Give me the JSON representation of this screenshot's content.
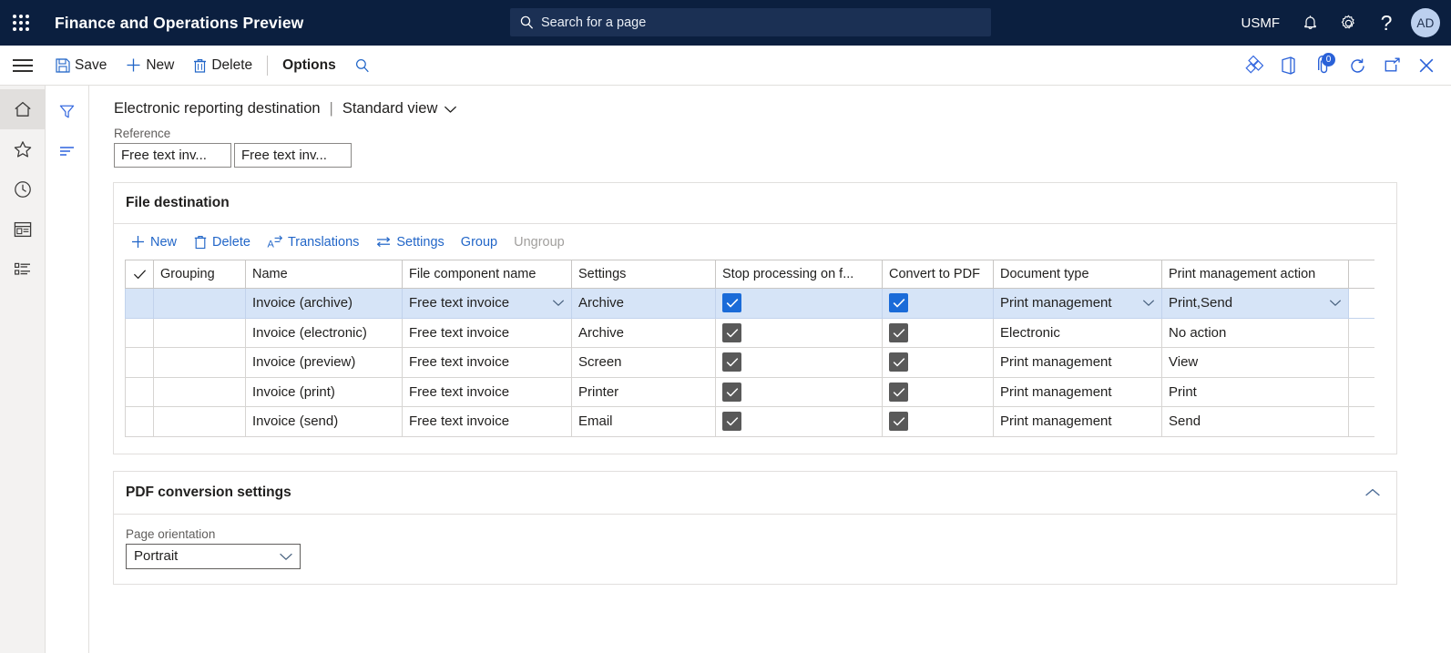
{
  "topbar": {
    "waffle_label": "App launcher",
    "app_title": "Finance and Operations Preview",
    "search_placeholder": "Search for a page",
    "search_value": "",
    "company": "USMF",
    "avatar_initials": "AD",
    "bg_color": "#0b1f3f",
    "search_bg": "#1b3054"
  },
  "commandbar": {
    "save_label": "Save",
    "new_label": "New",
    "delete_label": "Delete",
    "options_label": "Options",
    "notification_count": "0",
    "accent_color": "#2a61d8"
  },
  "navrail": {
    "items": [
      {
        "name": "home",
        "label": "Home",
        "active": true
      },
      {
        "name": "favorites",
        "label": "Favorites",
        "active": false
      },
      {
        "name": "recent",
        "label": "Recent",
        "active": false
      },
      {
        "name": "workspaces",
        "label": "Workspaces",
        "active": false
      },
      {
        "name": "modules",
        "label": "Modules",
        "active": false
      }
    ]
  },
  "filterrail": {
    "filter_label": "Filter",
    "sort_label": "Sort"
  },
  "page": {
    "title": "Electronic reporting destination",
    "separator": "|",
    "view_name": "Standard view",
    "reference_label": "Reference",
    "reference_fields": [
      "Free text inv...",
      "Free text inv..."
    ]
  },
  "file_destination": {
    "section_title": "File destination",
    "toolbar": [
      {
        "label": "New",
        "icon": "plus-icon",
        "disabled": false
      },
      {
        "label": "Delete",
        "icon": "trash-icon",
        "disabled": false
      },
      {
        "label": "Translations",
        "icon": "translate-icon",
        "disabled": false
      },
      {
        "label": "Settings",
        "icon": "settings-arrows-icon",
        "disabled": false
      },
      {
        "label": "Group",
        "icon": "none",
        "disabled": false
      },
      {
        "label": "Ungroup",
        "icon": "none",
        "disabled": true
      }
    ],
    "columns": [
      "Grouping",
      "Name",
      "File component name",
      "Settings",
      "Stop processing on f...",
      "Convert to PDF",
      "Document type",
      "Print management action"
    ],
    "rows": [
      {
        "selected": true,
        "grouping": "",
        "name": "Invoice (archive)",
        "file_component_name": "Free text invoice",
        "settings": "Archive",
        "stop_processing": true,
        "convert_to_pdf": true,
        "document_type": "Print management",
        "print_management_action": "Print,Send"
      },
      {
        "selected": false,
        "grouping": "",
        "name": "Invoice (electronic)",
        "file_component_name": "Free text invoice",
        "settings": "Archive",
        "stop_processing": true,
        "convert_to_pdf": true,
        "document_type": "Electronic",
        "print_management_action": "No action"
      },
      {
        "selected": false,
        "grouping": "",
        "name": "Invoice (preview)",
        "file_component_name": "Free text invoice",
        "settings": "Screen",
        "stop_processing": true,
        "convert_to_pdf": true,
        "document_type": "Print management",
        "print_management_action": "View"
      },
      {
        "selected": false,
        "grouping": "",
        "name": "Invoice (print)",
        "file_component_name": "Free text invoice",
        "settings": "Printer",
        "stop_processing": true,
        "convert_to_pdf": true,
        "document_type": "Print management",
        "print_management_action": "Print"
      },
      {
        "selected": false,
        "grouping": "",
        "name": "Invoice (send)",
        "file_component_name": "Free text invoice",
        "settings": "Email",
        "stop_processing": true,
        "convert_to_pdf": true,
        "document_type": "Print management",
        "print_management_action": "Send"
      }
    ],
    "selected_row_color": "#d6e4f7",
    "checkbox_on_color": "#1a6bd8",
    "checkbox_readonly_color": "#595959"
  },
  "pdf_settings": {
    "section_title": "PDF conversion settings",
    "collapsed": false,
    "page_orientation_label": "Page orientation",
    "page_orientation_value": "Portrait"
  }
}
